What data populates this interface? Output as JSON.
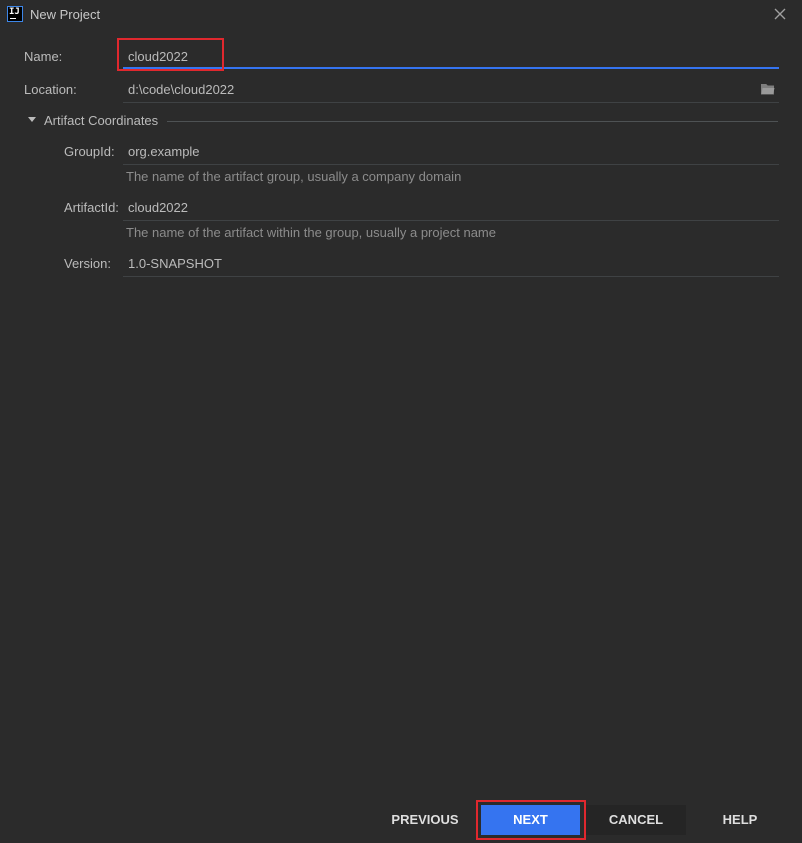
{
  "window": {
    "title": "New Project",
    "app_icon_text": "IJ"
  },
  "form": {
    "name": {
      "label": "Name:",
      "value": "cloud2022"
    },
    "location": {
      "label": "Location:",
      "value": "d:\\code\\cloud2022"
    }
  },
  "artifact": {
    "section_title": "Artifact Coordinates",
    "group_id": {
      "label": "GroupId:",
      "value": "org.example",
      "hint": "The name of the artifact group, usually a company domain"
    },
    "artifact_id": {
      "label": "ArtifactId:",
      "value": "cloud2022",
      "hint": "The name of the artifact within the group, usually a project name"
    },
    "version": {
      "label": "Version:",
      "value": "1.0-SNAPSHOT"
    }
  },
  "footer": {
    "previous": "PREVIOUS",
    "next": "NEXT",
    "cancel": "CANCEL",
    "help": "HELP"
  },
  "colors": {
    "background": "#2b2b2b",
    "accent": "#3574f0",
    "highlight": "#e0282e"
  },
  "icons": {
    "app": "intellij-app-icon",
    "close": "close-icon",
    "folder": "folder-icon",
    "section_toggle": "triangle-down-icon"
  }
}
